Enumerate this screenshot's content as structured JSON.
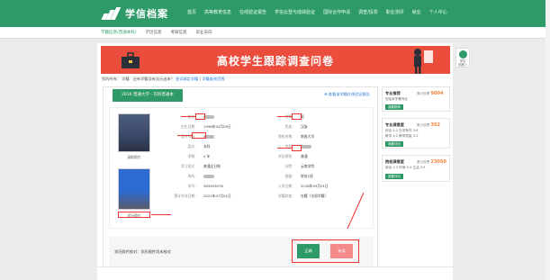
{
  "header": {
    "app_name": "学信档案",
    "nav": [
      "首页",
      "高等教育信息",
      "在线验证报告",
      "学信云登与成绩验证",
      "国际合作申请",
      "调查/投票",
      "职业测评",
      "就业",
      "个人中心"
    ]
  },
  "subnav": [
    "学籍信息(普通本科)",
    "学历信息",
    "考研信息",
    "毕业去向"
  ],
  "banner": {
    "title": "高校学生跟踪调查问卷"
  },
  "breadcrumb": {
    "prefix": "您的所有：",
    "item1": "学籍",
    "question": "还有学籍没有显示出来？",
    "link1": "尝试绑定学籍",
    "sep": "|",
    "link2": "学籍查询范围"
  },
  "card": {
    "tag": "2016 普通大学 - 在校普通本",
    "verify_link": "查看该学籍在线验证报告",
    "photo1_caption": "录取照片",
    "photo2_caption": "学历照片",
    "left_fields": [
      {
        "label": "姓名：",
        "value": ""
      },
      {
        "label": "出生日期：",
        "value": "1998年04月09日"
      },
      {
        "label": "证件号码：",
        "value": ""
      },
      {
        "label": "层次：",
        "value": "本科"
      },
      {
        "label": "学制：",
        "value": "4 年"
      },
      {
        "label": "学习形式：",
        "value": "普通全日制"
      },
      {
        "label": "系所：",
        "value": ""
      },
      {
        "label": "学号：",
        "value": "563403078"
      },
      {
        "label": "预计毕业日期：",
        "value": "2022年07月01日"
      }
    ],
    "right_fields": [
      {
        "label": "性别：",
        "value": "男"
      },
      {
        "label": "民族：",
        "value": "汉族"
      },
      {
        "label": "院校名称：",
        "value": "南昌大学"
      },
      {
        "label": "专业：",
        "value": ""
      },
      {
        "label": "学历类别：",
        "value": "普通"
      },
      {
        "label": "分院：",
        "value": "云南学院"
      },
      {
        "label": "班级：",
        "value": "财务1班"
      },
      {
        "label": "入学日期：",
        "value": "2018年09月01日"
      },
      {
        "label": "学籍状态：",
        "value": "在籍（注册学籍）"
      }
    ],
    "bottom_label": "学历照片校对：学历照片尚未校对",
    "btn_correct": "正确",
    "btn_wrong": "有误"
  },
  "side": [
    {
      "title": "专业推荐",
      "count_label": "累计投票",
      "count": "9004",
      "lines": [
        "您给本学籍专业"
      ],
      "button": "我要推荐"
    },
    {
      "title": "专业满意度",
      "count_label": "累计投票",
      "count": "352",
      "lines": [
        "综合 4.2  办学条件 3.6",
        "教学 4.2  教学质量 3.3"
      ],
      "button": "我要评价"
    },
    {
      "title": "院校满意度",
      "count_label": "累计投票",
      "count": "23050",
      "lines": [
        "综合 4.3  环境 4.4  生活 3.9"
      ],
      "button": "我要评价"
    }
  ],
  "float_widget": {
    "label": "学信\n机器人"
  },
  "colors": {
    "brand": "#2e9a67",
    "banner": "#eb4d3d",
    "annotation": "#e33333"
  }
}
